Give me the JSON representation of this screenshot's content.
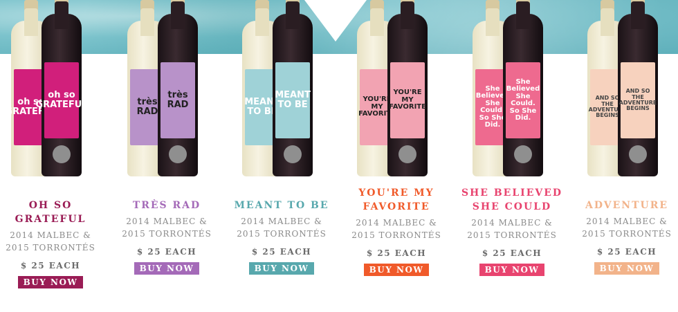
{
  "products": [
    {
      "name": "OH SO GRATEFUL",
      "desc1": "2014 MALBEC &",
      "desc2": "2015 TORRONTÉS",
      "price": "$ 25 EACH",
      "buy": "BUY NOW",
      "color": "#9a1c55",
      "label_text": "oh so GRATEFUL",
      "label_color": "#d11f7b",
      "label_text_color": "#ffffff"
    },
    {
      "name": "TRÈS RAD",
      "desc1": "2014 MALBEC &",
      "desc2": "2015 TORRONTÉS",
      "price": "$ 25 EACH",
      "buy": "BUY NOW",
      "color": "#a46ab8",
      "label_text": "très RAD",
      "label_color": "#b892c9",
      "label_text_color": "#222222"
    },
    {
      "name": "MEANT TO BE",
      "desc1": "2014 MALBEC &",
      "desc2": "2015 TORRONTÉS",
      "price": "$ 25 EACH",
      "buy": "BUY NOW",
      "color": "#58a8ad",
      "label_text": "MEANT TO BE",
      "label_color": "#9fd2d7",
      "label_text_color": "#ffffff"
    },
    {
      "name1": "YOU'RE MY",
      "name2": "FAVORITE",
      "desc1": "2014 MALBEC &",
      "desc2": "2015 TORRONTÉS",
      "price": "$ 25 EACH",
      "buy": "BUY NOW",
      "color": "#f05a2a",
      "label_text": "YOU'RE MY FAVORITE",
      "label_color": "#f2a3b2",
      "label_text_color": "#222222"
    },
    {
      "name1": "SHE BELIEVED",
      "name2": "SHE COULD",
      "desc1": "2014 MALBEC &",
      "desc2": "2015 TORRONTÉS",
      "price": "$ 25 EACH",
      "buy": "BUY NOW",
      "color": "#e8446f",
      "label_text": "She Believed She Could. So She Did.",
      "label_color": "#ee6a8f",
      "label_text_color": "#ffffff"
    },
    {
      "name": "ADVENTURE",
      "desc1": "2014 MALBEC &",
      "desc2": "2015 TORRONTÉS",
      "price": "$ 25 EACH",
      "buy": "BUY NOW",
      "color": "#f2b38a",
      "label_text": "AND SO THE ADVENTURE BEGINS",
      "label_color": "#f7d2be",
      "label_text_color": "#444444"
    }
  ]
}
